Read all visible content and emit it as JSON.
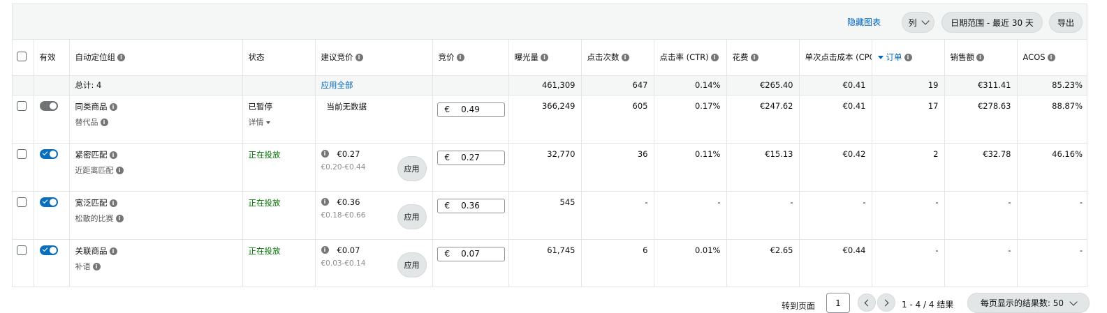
{
  "toolbar": {
    "hide_chart": "隐藏图表",
    "columns": "列",
    "date_range": "日期范围 - 最近 30 天",
    "export": "导出"
  },
  "columns": {
    "active": "有效",
    "group": "自动定位组",
    "status": "状态",
    "suggested_bid": "建议竞价",
    "bid": "竞价",
    "impressions": "曝光量",
    "clicks": "点击次数",
    "ctr": "点击率 (CTR)",
    "spend": "花费",
    "cpc": "单次点击成本 (CPC)",
    "orders": "订单",
    "sales": "销售额",
    "acos": "ACOS"
  },
  "total": {
    "label": "总计: 4",
    "apply_all": "应用全部",
    "impressions": "461,309",
    "clicks": "647",
    "ctr": "0.14%",
    "spend": "€265.40",
    "cpc": "€0.41",
    "orders": "19",
    "sales": "€311.41",
    "acos": "85.23%"
  },
  "rows": [
    {
      "name": "同类商品",
      "sub": "替代品",
      "enabled": false,
      "status": "已暂停",
      "status_detail": "详情",
      "suggested_text": "当前无数据",
      "currency": "€",
      "bid": "0.49",
      "impressions": "366,249",
      "clicks": "605",
      "ctr": "0.17%",
      "spend": "€247.62",
      "cpc": "€0.41",
      "orders": "17",
      "sales": "€278.63",
      "acos": "88.87%"
    },
    {
      "name": "紧密匹配",
      "sub": "近距离匹配",
      "enabled": true,
      "status": "正在投放",
      "suggested": "€0.27",
      "suggested_range": "€0.20-€0.44",
      "apply": "应用",
      "currency": "€",
      "bid": "0.27",
      "impressions": "32,770",
      "clicks": "36",
      "ctr": "0.11%",
      "spend": "€15.13",
      "cpc": "€0.42",
      "orders": "2",
      "sales": "€32.78",
      "acos": "46.16%"
    },
    {
      "name": "宽泛匹配",
      "sub": "松散的比赛",
      "enabled": true,
      "status": "正在投放",
      "suggested": "€0.36",
      "suggested_range": "€0.18-€0.66",
      "apply": "应用",
      "currency": "€",
      "bid": "0.36",
      "impressions": "545",
      "clicks": "-",
      "ctr": "-",
      "spend": "-",
      "cpc": "-",
      "orders": "-",
      "sales": "-",
      "acos": "-"
    },
    {
      "name": "关联商品",
      "sub": "补语",
      "enabled": true,
      "status": "正在投放",
      "suggested": "€0.07",
      "suggested_range": "€0.03-€0.14",
      "apply": "应用",
      "currency": "€",
      "bid": "0.07",
      "impressions": "61,745",
      "clicks": "6",
      "ctr": "0.01%",
      "spend": "€2.65",
      "cpc": "€0.44",
      "orders": "-",
      "sales": "-",
      "acos": "-"
    }
  ],
  "footer": {
    "goto_label": "转到页面",
    "page": "1",
    "range": "1 - 4 / 4 结果",
    "per_page": "每页显示的结果数: 50"
  },
  "colors": {
    "link": "#0066c0",
    "active_status": "#007600",
    "toggle_on": "#0a6ebd",
    "toggle_off": "#6f7373"
  }
}
